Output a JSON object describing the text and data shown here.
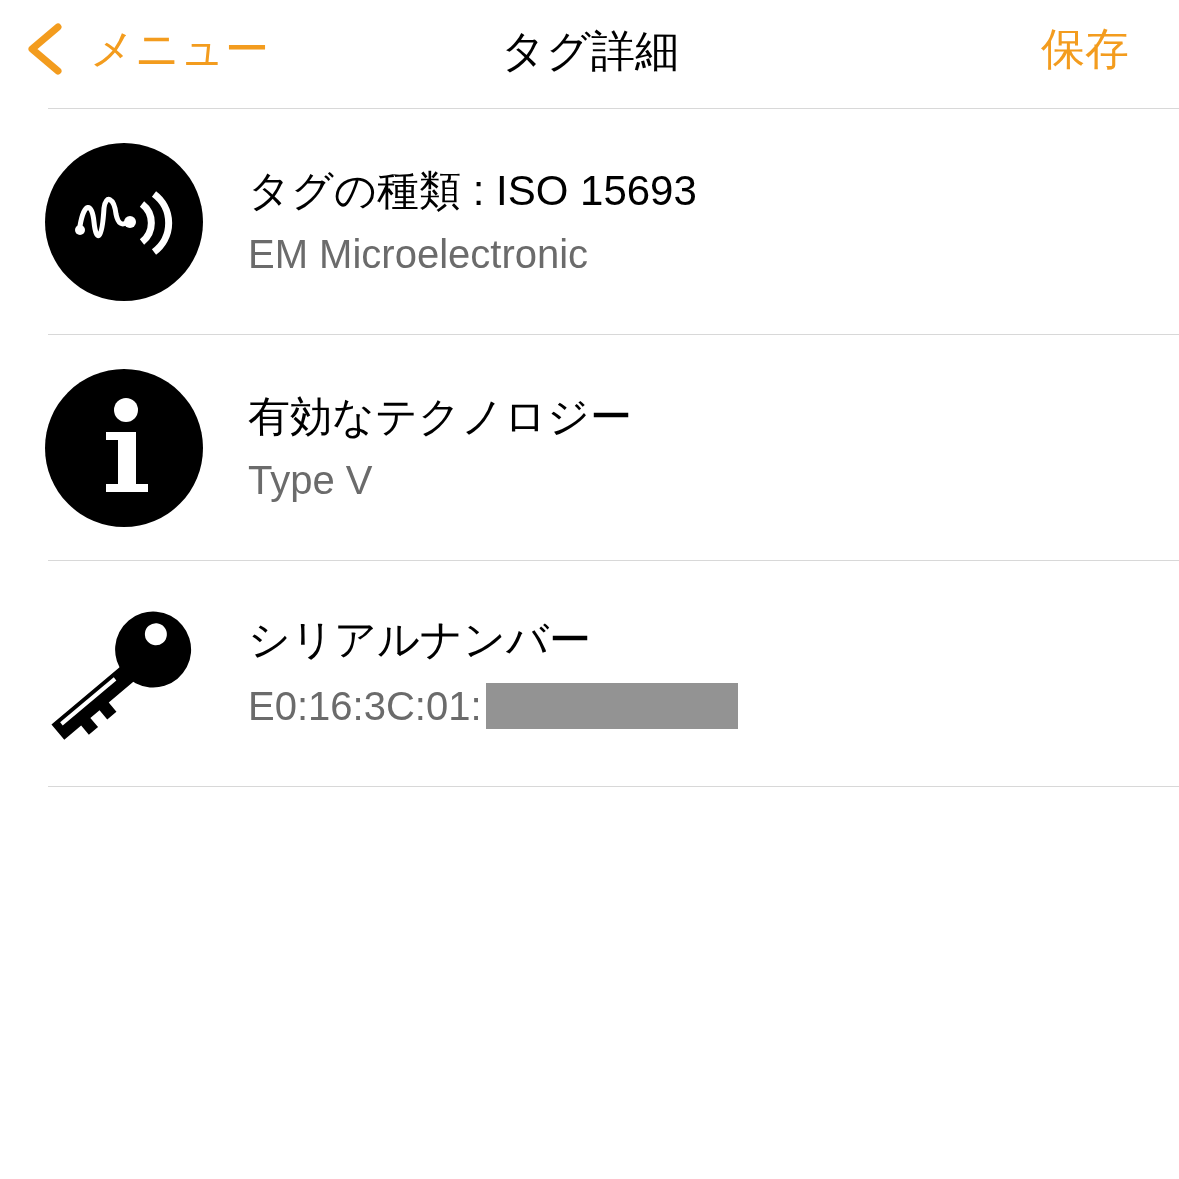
{
  "nav": {
    "back": "メニュー",
    "title": "タグ詳細",
    "action": "保存"
  },
  "rows": [
    {
      "kind": "nfc",
      "title": "タグの種類 : ISO 15693",
      "subtitle": "EM Microelectronic",
      "redacted": false
    },
    {
      "kind": "info",
      "title": "有効なテクノロジー",
      "subtitle": "Type V",
      "redacted": false
    },
    {
      "kind": "key",
      "title": "シリアルナンバー",
      "subtitle": "E0:16:3C:01:",
      "redacted": true
    }
  ]
}
